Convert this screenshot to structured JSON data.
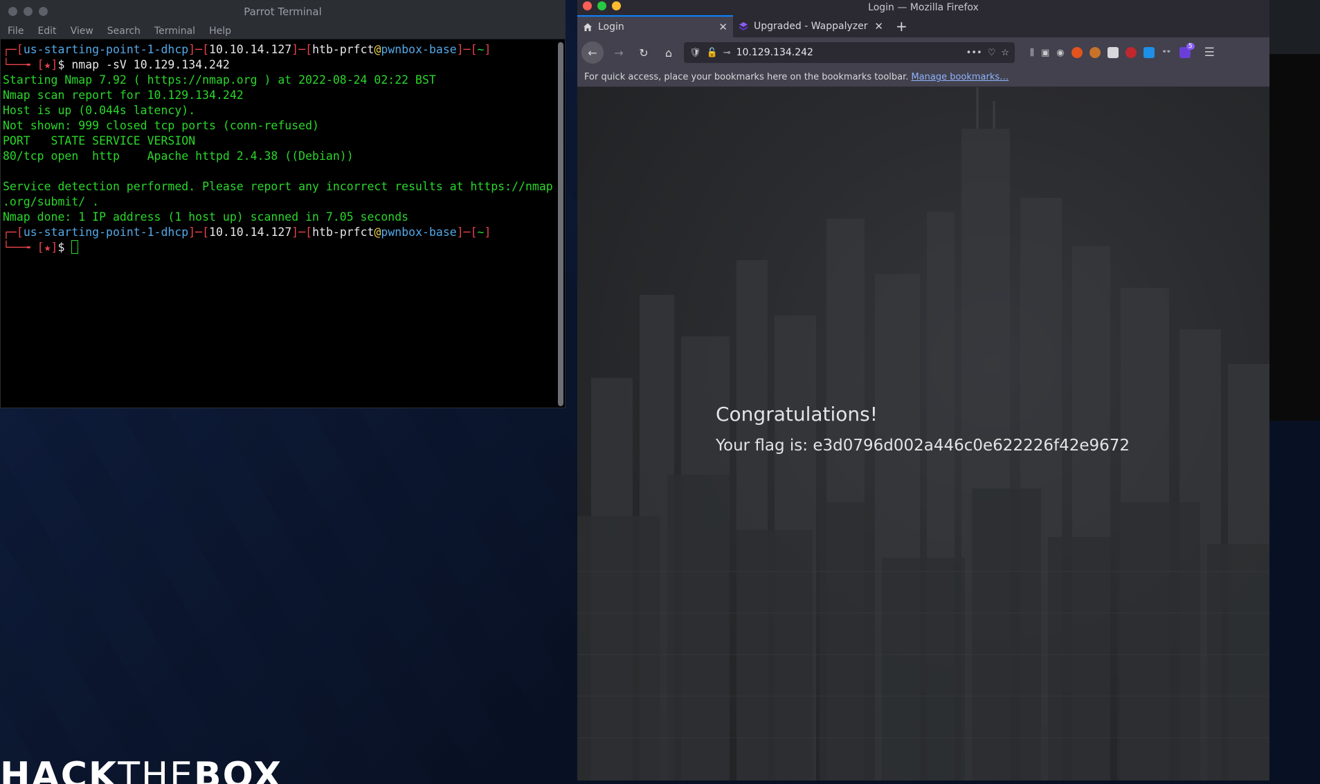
{
  "desktop": {
    "logo_bold_1": "HACK",
    "logo_thin": "THE",
    "logo_bold_2": "BOX"
  },
  "terminal": {
    "title": "Parrot Terminal",
    "menu": [
      "File",
      "Edit",
      "View",
      "Search",
      "Terminal",
      "Help"
    ],
    "prompt": {
      "bracket_open": "┌─[",
      "vpn": "us-starting-point-1-dhcp",
      "mid1": "]─[",
      "ip": "10.10.14.127",
      "mid2": "]─[",
      "user": "htb-prfct",
      "at": "@",
      "host": "pwnbox-base",
      "mid3": "]─[",
      "dir": "~",
      "close": "]",
      "line2_prefix": "└──╼ ",
      "star": "[★]",
      "dollar": "$ "
    },
    "command": "nmap -sV 10.129.134.242",
    "output": [
      "Starting Nmap 7.92 ( https://nmap.org ) at 2022-08-24 02:22 BST",
      "Nmap scan report for 10.129.134.242",
      "Host is up (0.044s latency).",
      "Not shown: 999 closed tcp ports (conn-refused)",
      "PORT   STATE SERVICE VERSION",
      "80/tcp open  http    Apache httpd 2.4.38 ((Debian))",
      "",
      "Service detection performed. Please report any incorrect results at https://nmap",
      ".org/submit/ .",
      "Nmap done: 1 IP address (1 host up) scanned in 7.05 seconds"
    ]
  },
  "firefox": {
    "window_title": "Login — Mozilla Firefox",
    "tabs": [
      {
        "label": "Login",
        "active": true
      },
      {
        "label": "Upgraded - Wappalyzer",
        "active": false
      }
    ],
    "url": "10.129.134.242",
    "bookmarks_text": "For quick access, place your bookmarks here on the bookmarks toolbar.",
    "bookmarks_link": "Manage bookmarks…",
    "extension_badge": "5",
    "page": {
      "heading": "Congratulations!",
      "flag_text": "Your flag is: e3d0796d002a446c0e622226f42e9672"
    }
  },
  "colors": {
    "terminal_green": "#2ad72a",
    "prompt_red": "#e8434b",
    "prompt_cyan": "#54a8e8",
    "firefox_accent": "#0a84ff"
  }
}
